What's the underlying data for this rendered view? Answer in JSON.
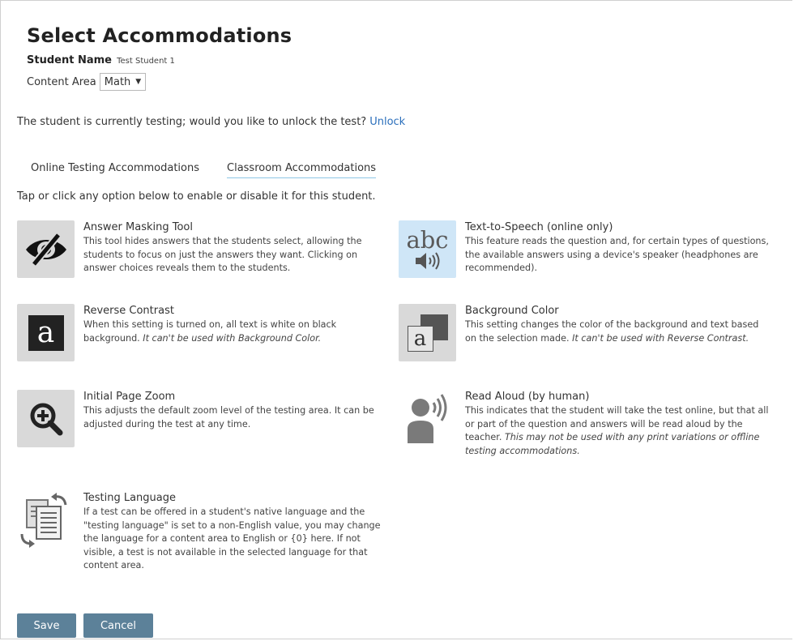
{
  "page": {
    "title": "Select Accommodations",
    "student_name_label": "Student Name",
    "student_name_value": "Test Student 1",
    "content_area_label": "Content Area",
    "content_area_value": "Math",
    "unlock_prompt": "The student is currently testing; would you like to unlock the test?",
    "unlock_link": "Unlock",
    "instructions": "Tap or click any option below to enable or disable it for this student."
  },
  "tabs": [
    {
      "label": "Online Testing Accommodations",
      "active": false
    },
    {
      "label": "Classroom Accommodations",
      "active": true
    }
  ],
  "options": {
    "answer_masking": {
      "name": "Answer Masking Tool",
      "desc": "This tool hides answers that the students select, allowing the students to focus on just the answers they want. Clicking on answer choices reveals them to the students.",
      "icon": "eye-slash-icon"
    },
    "text_to_speech": {
      "name": "Text-to-Speech (online only)",
      "desc": "This feature reads the question and, for certain types of questions, the available answers using a device's speaker (headphones are recommended).",
      "icon": "abc-speaker-icon",
      "icon_text": "abc"
    },
    "reverse_contrast": {
      "name": "Reverse Contrast",
      "desc": "When this setting is turned on, all text is white on black background.",
      "note": "It can't be used with Background Color.",
      "icon": "reverse-contrast-icon",
      "icon_text": "a"
    },
    "background_color": {
      "name": "Background Color",
      "desc": "This setting changes the color of the background and text based on the selection made.",
      "note": "It can't be used with Reverse Contrast.",
      "icon": "background-color-icon",
      "icon_text": "a"
    },
    "page_zoom": {
      "name": "Initial Page Zoom",
      "desc": "This adjusts the default zoom level of the testing area. It can be adjusted during the test at any time.",
      "icon": "zoom-in-icon"
    },
    "read_aloud": {
      "name": "Read Aloud (by human)",
      "desc": "This indicates that the student will take the test online, but that all or part of the question and answers will be read aloud by the teacher.",
      "note": "This may not be used with any print variations or offline testing accommodations.",
      "icon": "person-speaking-icon"
    },
    "testing_language": {
      "name": "Testing Language",
      "desc": "If a test can be offered in a student's native language and the \"testing language\" is set to a non-English value, you may change the language for a content area to English or {0} here. If not visible, a test is not available in the selected language for that content area.",
      "icon": "language-swap-icon"
    }
  },
  "buttons": {
    "save": "Save",
    "cancel": "Cancel"
  },
  "colors": {
    "link": "#2a6ebb",
    "button": "#5c8199",
    "tile_gray": "#d9d9d9",
    "tile_blue": "#cfe6f7",
    "tab_underline": "#8ec6e6"
  }
}
